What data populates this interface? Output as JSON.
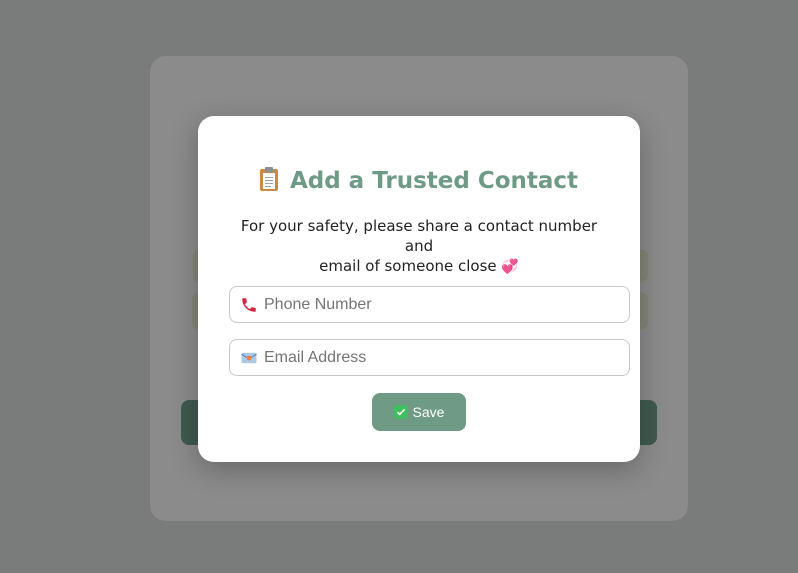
{
  "modal": {
    "title": "Add a Trusted Contact",
    "title_icon": "clipboard-icon",
    "description_line1": "For your safety, please share a contact number and",
    "description_line2": "email of someone close",
    "description_icon": "two-hearts-icon",
    "description_icon_glyph": "💞",
    "phone": {
      "icon": "telephone-icon",
      "placeholder": "Phone Number",
      "value": ""
    },
    "email": {
      "icon": "email-icon",
      "placeholder": "Email Address",
      "value": ""
    },
    "save_label": "Save",
    "save_icon": "check-icon"
  },
  "colors": {
    "accent": "#6e9a86",
    "overlay": "#7a7b7b",
    "background_button": "#3f5a4e"
  }
}
